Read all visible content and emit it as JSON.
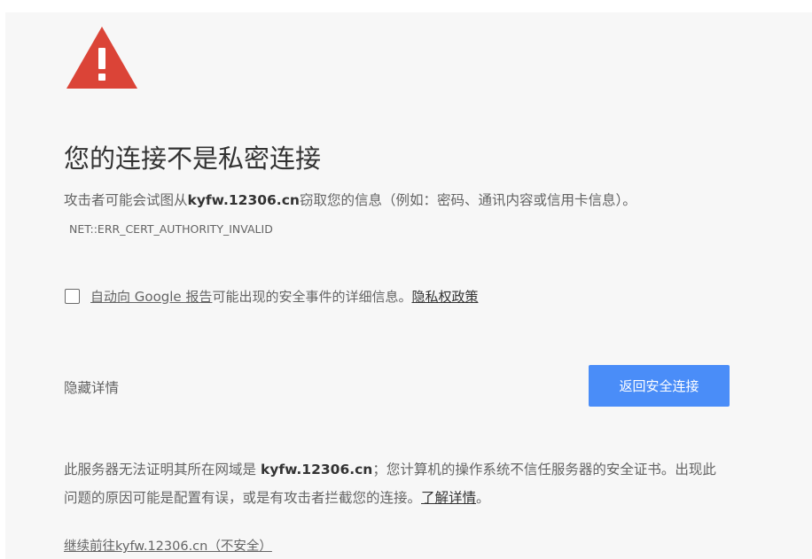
{
  "icon": {
    "name": "warning-triangle-icon",
    "color": "#db4437"
  },
  "heading": "您的连接不是私密连接",
  "main_message": {
    "prefix": "攻击者可能会试图从",
    "host": "kyfw.12306.cn",
    "suffix": "窃取您的信息（例如：密码、通讯内容或信用卡信息）。",
    "error_code": "NET::ERR_CERT_AUTHORITY_INVALID"
  },
  "report": {
    "checked": false,
    "link_text": "自动向 Google 报告",
    "text": "可能出现的安全事件的详细信息。",
    "privacy_link": "隐私权政策"
  },
  "hide_details": "隐藏详情",
  "back_button": "返回安全连接",
  "details": {
    "prefix": "此服务器无法证明其所在网域是 ",
    "host": "kyfw.12306.cn",
    "suffix": "；您计算机的操作系统不信任服务器的安全证书。出现此问题的原因可能是配置有误，或是有攻击者拦截您的连接。",
    "learn_more": "了解详情",
    "end": "。"
  },
  "proceed_link": "继续前往kyfw.12306.cn（不安全）",
  "colors": {
    "background": "#f7f7f7",
    "button": "#4a8df8",
    "warning": "#db4437",
    "text": "#646464",
    "heading": "#333333"
  }
}
